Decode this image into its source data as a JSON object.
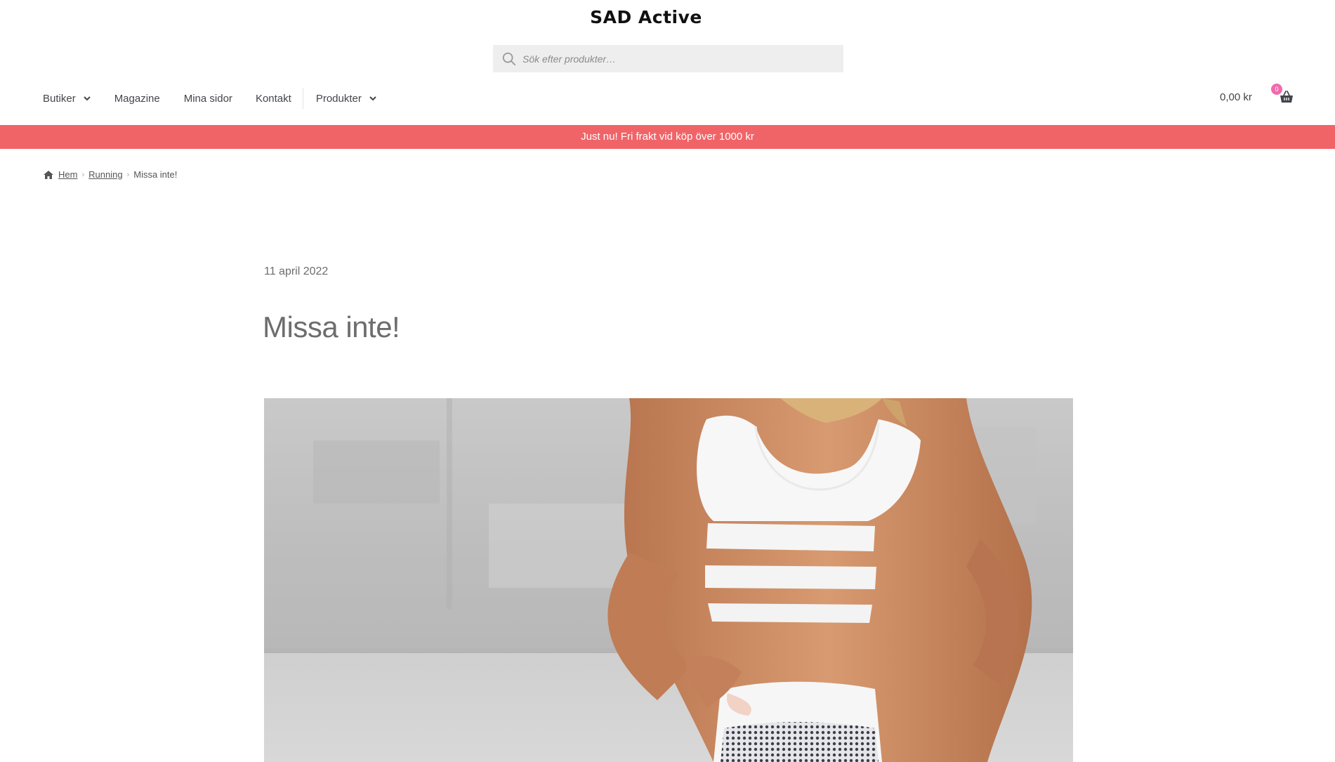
{
  "header": {
    "site_title": "SAD Active",
    "search_placeholder": "Sök efter produkter…"
  },
  "nav": {
    "items": [
      {
        "label": "Butiker",
        "has_dropdown": true
      },
      {
        "label": "Magazine",
        "has_dropdown": false
      },
      {
        "label": "Mina sidor",
        "has_dropdown": false
      },
      {
        "label": "Kontakt",
        "has_dropdown": false
      },
      {
        "label": "Produkter",
        "has_dropdown": true
      }
    ]
  },
  "cart": {
    "total": "0,00 kr",
    "count": "0",
    "icon": "basket-icon"
  },
  "promo_banner": {
    "text": "Just nu! Fri frakt vid köp över 1000 kr",
    "background_color": "#f06468"
  },
  "breadcrumb": {
    "icon": "home-icon",
    "items": [
      "Hem",
      "Running",
      "Missa inte!"
    ]
  },
  "post": {
    "date": "11 april 2022",
    "title": "Missa inte!"
  },
  "colors": {
    "accent": "#f06468",
    "badge": "#f16bac",
    "text": "#43454b"
  }
}
